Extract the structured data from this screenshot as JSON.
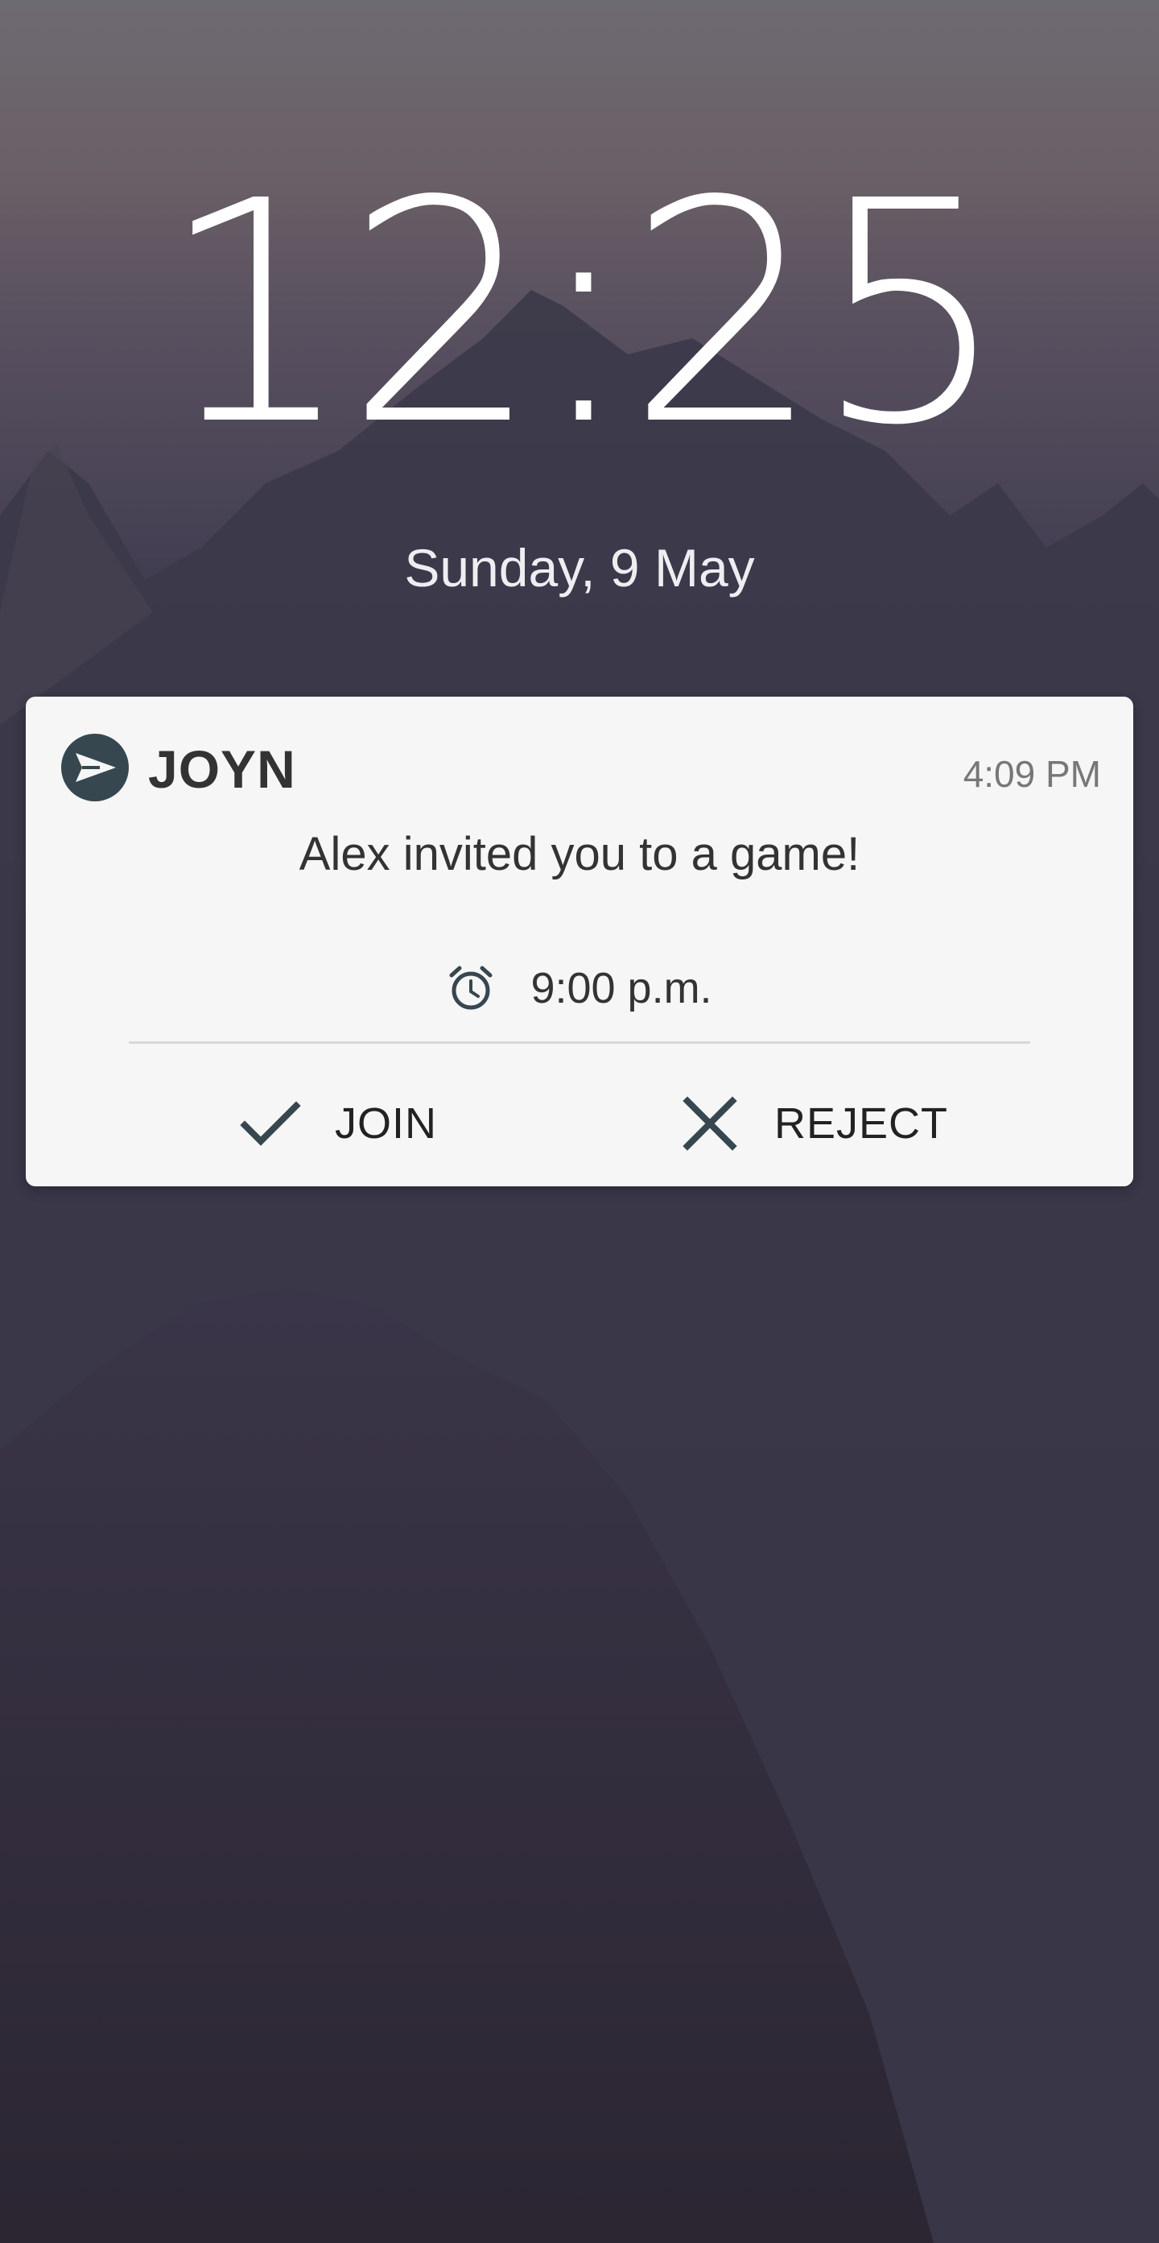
{
  "lockscreen": {
    "time": "12:25",
    "date": "Sunday, 9 May"
  },
  "notification": {
    "app_name": "JOYN",
    "app_icon": "paper-plane-icon",
    "timestamp": "4:09 PM",
    "message": "Alex invited you to a game!",
    "event_icon": "alarm-clock-icon",
    "event_time": "9:00 p.m.",
    "actions": [
      {
        "label": "JOIN",
        "icon": "checkmark-icon"
      },
      {
        "label": "REJECT",
        "icon": "close-icon"
      }
    ]
  },
  "colors": {
    "card_background": "#f6f6f6",
    "icon_color": "#37474f",
    "text_primary": "#333333"
  }
}
